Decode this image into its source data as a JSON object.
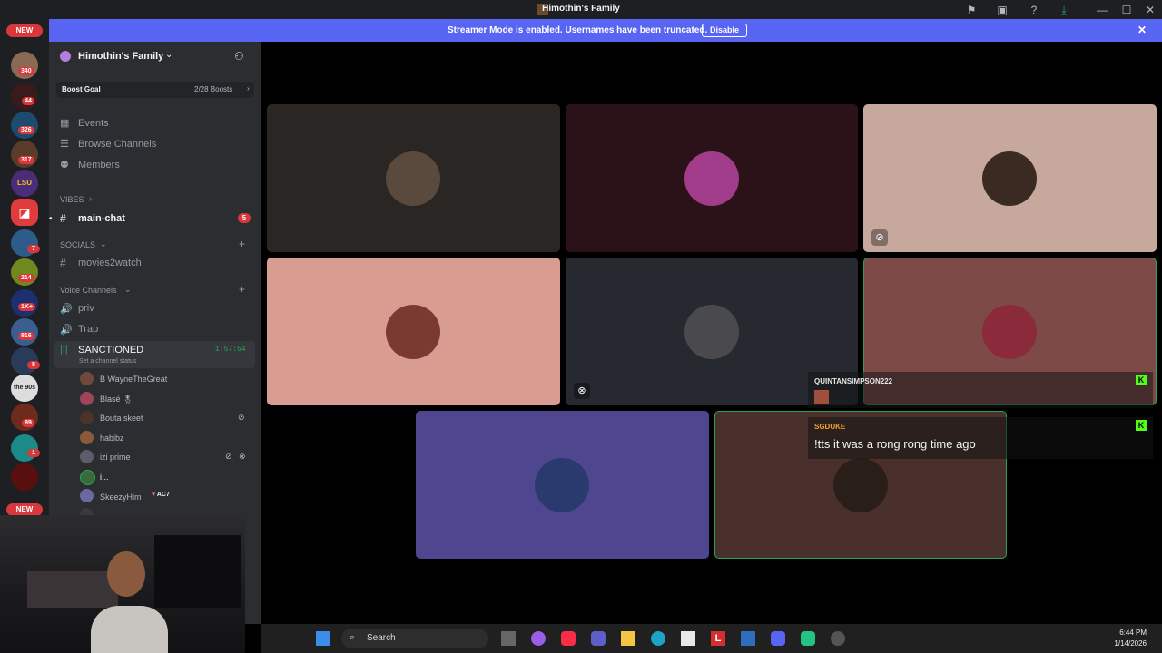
{
  "window": {
    "title": "Himothin's Family"
  },
  "banner": {
    "message": "Streamer Mode is enabled. Usernames have been truncated.",
    "button": "Disable"
  },
  "rail": {
    "new_top": "NEW",
    "new_bottom": "NEW",
    "badges": [
      "340",
      "44",
      "326",
      "317",
      "7",
      "214",
      "1K+",
      "816",
      "8",
      "89",
      "1"
    ],
    "server_tags": [
      "LSU",
      "the 90s"
    ]
  },
  "server": {
    "name": "Himothin's Family",
    "boost_label": "Boost Goal",
    "boost_count": "2/28 Boosts",
    "menu": [
      "Events",
      "Browse Channels",
      "Members"
    ],
    "vibes_category": "VIBES",
    "main_chat": "main-chat",
    "main_chat_badge": "5",
    "socials_category": "SOCIALS",
    "movies": "movies2watch",
    "voice_category": "Voice Channels",
    "voice_channels": [
      "priv",
      "Trap"
    ],
    "active_voice": "SANCTIONED",
    "active_timer": "1:57:54",
    "channel_status": "Set a channel status",
    "voice_users": [
      "B WayneTheGreat",
      "Blasé 🎖",
      "Bouta skeet",
      "habibz",
      "izi prime",
      "i...",
      "SkeezyHim"
    ],
    "skeezy_tag": "AC7"
  },
  "chat_overlay": [
    {
      "user": "QUINTANSIMPSON222",
      "message": ""
    },
    {
      "user": "SGDUKE",
      "message": "!tts it was a rong rong time ago"
    }
  ],
  "taskbar": {
    "search": "Search",
    "time": "6:44 PM",
    "date": "1/14/2026"
  },
  "colors": {
    "brand": "#5865f2",
    "speaking": "#23a55a",
    "badge": "#da373c"
  },
  "tiles": [
    {
      "bg": "#2a2624"
    },
    {
      "bg": "#2b1218"
    },
    {
      "bg": "#c6a89c"
    },
    {
      "bg": "#d99c91"
    },
    {
      "bg": "#272930"
    },
    {
      "bg": "#7d4a48"
    },
    {
      "bg": "#4e4790"
    },
    {
      "bg": "#4a302c"
    }
  ]
}
